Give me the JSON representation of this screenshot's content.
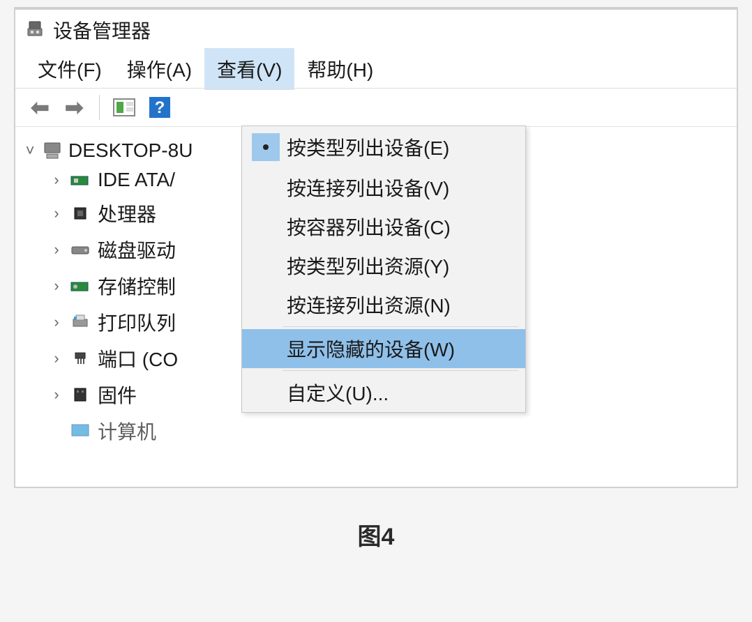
{
  "window": {
    "title": "设备管理器"
  },
  "menubar": {
    "file": "文件(F)",
    "action": "操作(A)",
    "view": "查看(V)",
    "help": "帮助(H)"
  },
  "dropdown": {
    "devices_by_type": "按类型列出设备(E)",
    "devices_by_connection": "按连接列出设备(V)",
    "devices_by_container": "按容器列出设备(C)",
    "resources_by_type": "按类型列出资源(Y)",
    "resources_by_connection": "按连接列出资源(N)",
    "show_hidden": "显示隐藏的设备(W)",
    "customize": "自定义(U)..."
  },
  "tree": {
    "root": "DESKTOP-8U",
    "nodes": {
      "ide": "IDE ATA/",
      "cpu": "处理器",
      "disk": "磁盘驱动",
      "storage": "存储控制",
      "printq": "打印队列",
      "ports": "端口 (CO",
      "firmware": "固件",
      "computer": "计算机"
    }
  },
  "caption": "图4"
}
